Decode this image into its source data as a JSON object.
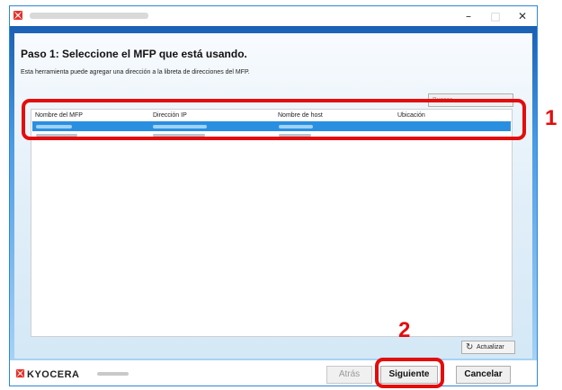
{
  "window": {
    "title_blurred": true,
    "controls": {
      "minimize": "–",
      "maximize": "□",
      "close": "✕"
    }
  },
  "step": {
    "title": "Paso 1: Seleccione el MFP que está usando.",
    "description": "Esta herramienta puede agregar una dirección a la libreta de direcciones del MFP."
  },
  "search": {
    "placeholder": "Buscar"
  },
  "table": {
    "columns": [
      "Nombre del MFP",
      "Dirección IP",
      "Nombre de host",
      "Ubicación"
    ],
    "selected_row_blurred": true
  },
  "refresh_button": {
    "label": "Actualizar",
    "icon": "refresh-icon"
  },
  "footer": {
    "brand": "KYOCERA",
    "back_label": "Atrás",
    "next_label": "Siguiente",
    "cancel_label": "Cancelar"
  },
  "callouts": {
    "one": "1",
    "two": "2"
  },
  "colors": {
    "accent_blue": "#2b8fe0",
    "callout_red": "#e30d0d",
    "brand_red": "#e4322b"
  }
}
